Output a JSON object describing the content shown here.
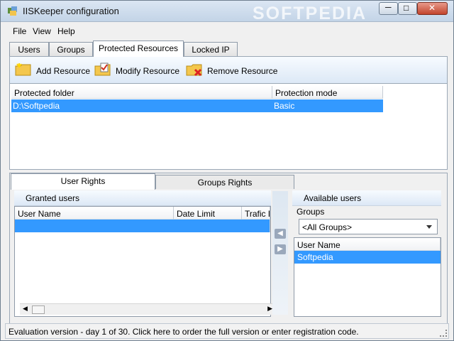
{
  "window": {
    "title": "IISKeeper configuration",
    "watermark": "SOFTPEDIA",
    "controls": {
      "minimize": "─",
      "maximize": "□",
      "close": "✕"
    }
  },
  "menu": [
    "File",
    "View",
    "Help"
  ],
  "top_tabs": [
    "Users",
    "Groups",
    "Protected Resources",
    "Locked IP"
  ],
  "toolbar": {
    "add": "Add Resource",
    "modify": "Modify Resource",
    "remove": "Remove Resource"
  },
  "protected_list": {
    "headers": [
      "Protected folder",
      "Protection mode"
    ],
    "rows": [
      [
        "D:\\Softpedia",
        "Basic"
      ]
    ]
  },
  "lower_tabs": [
    "User Rights",
    "Groups Rights"
  ],
  "granted": {
    "title": "Granted users",
    "headers": [
      "User Name",
      "Date Limit",
      "Trafic Li"
    ]
  },
  "available": {
    "title": "Available users",
    "groups_label": "Groups",
    "groups_value": "<All Groups>",
    "header": "User Name",
    "rows": [
      "Softpedia"
    ]
  },
  "status": "Evaluation version - day 1 of 30. Click here to order the full version or enter registration code."
}
